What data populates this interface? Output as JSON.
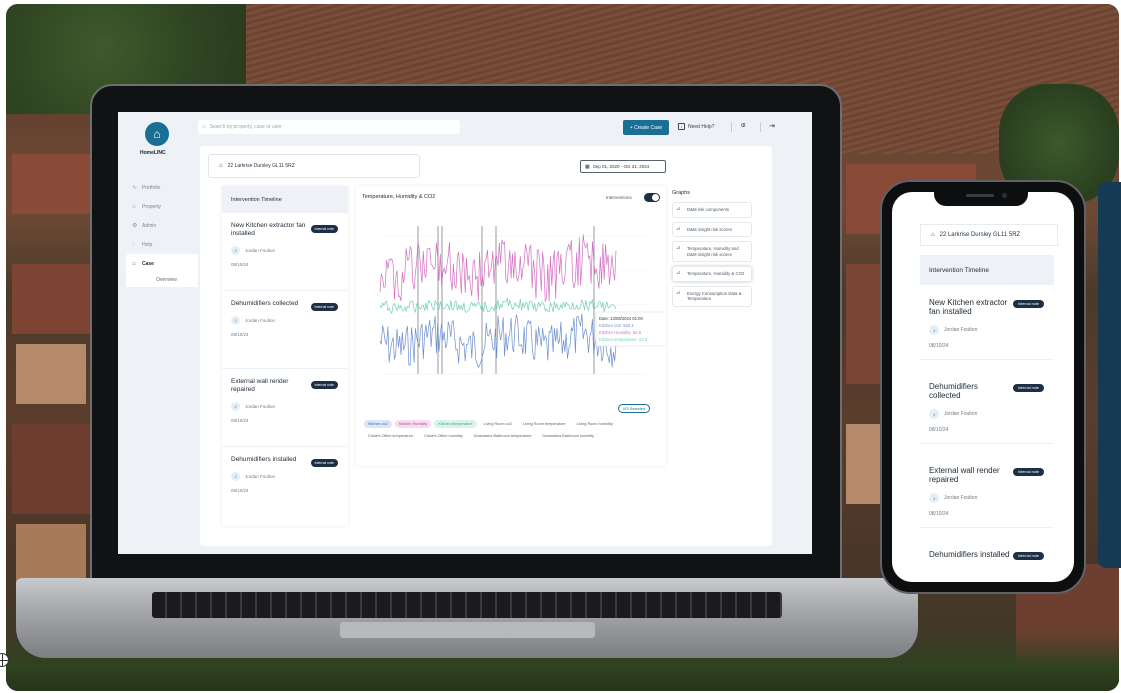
{
  "app": {
    "brand": "HomeLINC",
    "search_placeholder": "Search by property, case or user",
    "create_case": "+ Create Case",
    "need_help": "Need Help?",
    "nav": [
      {
        "label": "Portfolio",
        "icon": "trend-icon"
      },
      {
        "label": "Property",
        "icon": "house-icon"
      },
      {
        "label": "Admin",
        "icon": "gear-icon"
      },
      {
        "label": "Help",
        "icon": "help-icon"
      },
      {
        "label": "Case",
        "icon": "case-icon",
        "active": true
      }
    ],
    "nav_sub": "Overview"
  },
  "case": {
    "address": "22 Larkrise Dursley GL11 5RZ",
    "date_range": "Sep 01, 2020 - Oct 31, 2024"
  },
  "timeline": {
    "header": "Intervention Timeline",
    "items": [
      {
        "title": "New Kitchen extractor fan installed",
        "badge": "Internal note",
        "user": "Jordan Foulton",
        "date": "08/10/24"
      },
      {
        "title": "Dehumidifiers collected",
        "badge": "Internal note",
        "user": "Jordan Foulton",
        "date": "08/10/24"
      },
      {
        "title": "External wall render repaired",
        "badge": "Internal note",
        "user": "Jordan Foulton",
        "date": "08/10/24"
      },
      {
        "title": "Dehumidifiers installed",
        "badge": "Internal note",
        "user": "Jordan Foulton",
        "date": "08/10/24"
      }
    ]
  },
  "chart": {
    "title": "Temperature, Humidity & CO2",
    "interventions_label": "Interventions",
    "select_button": "0/3 Selected",
    "legend": [
      {
        "label": "Kitchen co2",
        "style": "blue"
      },
      {
        "label": "Kitchen Humidity",
        "style": "pink"
      },
      {
        "label": "Kitchen temperature",
        "style": "green"
      },
      {
        "label": "Living Room co2",
        "style": "plain"
      },
      {
        "label": "Living Room temperature",
        "style": "plain"
      },
      {
        "label": "Living Room humidity",
        "style": "plain"
      },
      {
        "label": "Chloe's Office temperature",
        "style": "plain"
      },
      {
        "label": "Chloe's Office humidity",
        "style": "plain"
      },
      {
        "label": "Downstairs Bathroom temperature",
        "style": "plain"
      },
      {
        "label": "Downstairs Bathroom humidity",
        "style": "plain"
      }
    ],
    "tooltip": {
      "date": "Date: 13/08/2024 01:00",
      "co2": "Kitchen co2: 520.1",
      "humidity": "Kitchen Humidity: 54.8",
      "temp": "Kitchen temperature: 22.3"
    }
  },
  "chart_data": {
    "type": "line",
    "title": "Temperature, Humidity & CO2",
    "series": [
      {
        "name": "Kitchen co2",
        "color": "#6d8fd0"
      },
      {
        "name": "Kitchen Humidity",
        "color": "#d36fc3"
      },
      {
        "name": "Kitchen temperature",
        "color": "#6fd1b0"
      }
    ]
  },
  "graphs": {
    "title": "Graphs",
    "items": [
      {
        "label": "D&M risk components"
      },
      {
        "label": "D&M insight risk scores"
      },
      {
        "label": "Temperature, Humidity and D&M insight risk scores"
      },
      {
        "label": "Temperature, Humidity & CO2",
        "active": true
      },
      {
        "label": "Energy Consumption Data & Temperature"
      }
    ]
  },
  "colors": {
    "brand": "#1a6f95",
    "dark": "#1d2f44"
  }
}
